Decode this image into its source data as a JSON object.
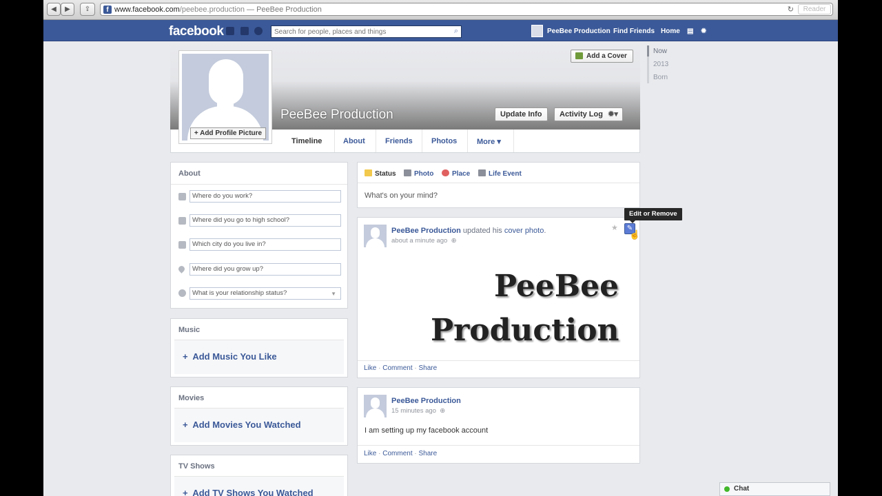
{
  "browser": {
    "url_domain": "www.facebook.com",
    "url_path": "/peebee.production",
    "url_title": " — PeeBee Production",
    "reader_label": "Reader",
    "favicon_letter": "f"
  },
  "topbar": {
    "logo": "facebook",
    "search_placeholder": "Search for people, places and things",
    "user_name": "PeeBee Production",
    "find_friends": "Find Friends",
    "home": "Home"
  },
  "cover": {
    "add_cover_label": "Add a Cover",
    "profile_name": "PeeBee Production",
    "update_info_label": "Update Info",
    "activity_log_label": "Activity Log",
    "add_profile_picture_label": "+ Add Profile Picture"
  },
  "tabs": [
    "Timeline",
    "About",
    "Friends",
    "Photos",
    "More ▾"
  ],
  "scrubber": [
    "Now",
    "2013",
    "Born"
  ],
  "about": {
    "title": "About",
    "fields": [
      "Where do you work?",
      "Where did you go to high school?",
      "Which city do you live in?",
      "Where did you grow up?",
      "What is your relationship status?"
    ]
  },
  "sections": [
    {
      "title": "Music",
      "add": "Add Music You Like"
    },
    {
      "title": "Movies",
      "add": "Add Movies You Watched"
    },
    {
      "title": "TV Shows",
      "add": "Add TV Shows You Watched"
    }
  ],
  "composer": {
    "tabs": [
      "Status",
      "Photo",
      "Place",
      "Life Event"
    ],
    "placeholder": "What's on your mind?"
  },
  "posts": [
    {
      "author": "PeeBee Production",
      "action": " updated his ",
      "object": "cover photo",
      "period": ".",
      "time": "about a minute ago",
      "image_text_1": "PeeBee",
      "image_text_2": "Production",
      "actions": [
        "Like",
        "Comment",
        "Share"
      ]
    },
    {
      "author": "PeeBee Production",
      "time": "15 minutes ago",
      "text": "I am setting up my facebook account",
      "actions": [
        "Like",
        "Comment",
        "Share"
      ]
    }
  ],
  "tooltip": "Edit or Remove",
  "chat": "Chat",
  "colors": {
    "brand": "#3b5998",
    "link": "#3b5998",
    "background": "#e9eaed"
  }
}
